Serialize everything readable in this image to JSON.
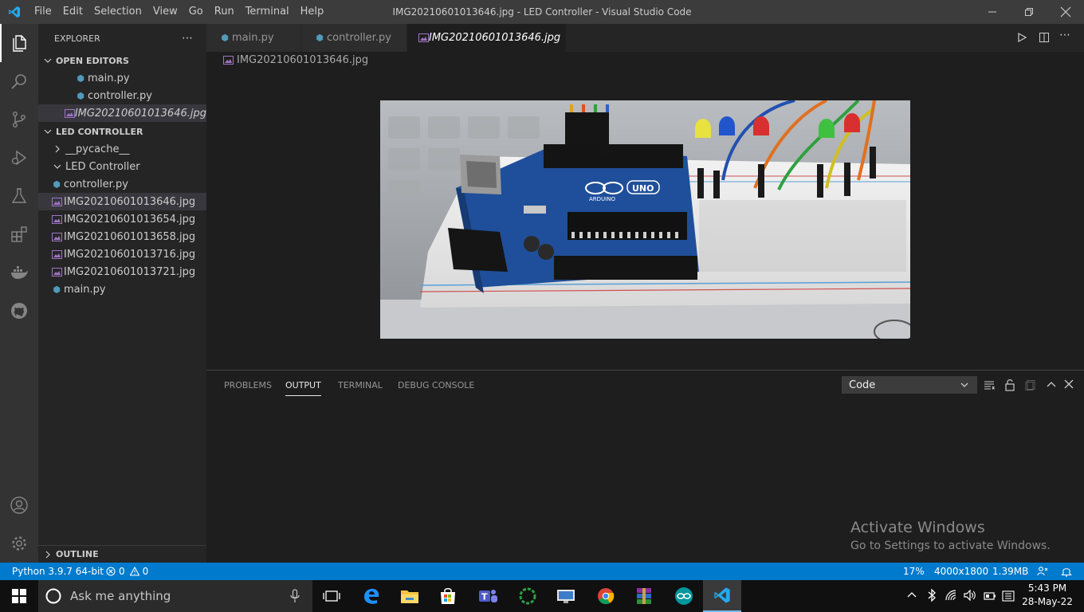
{
  "window": {
    "title": "IMG20210601013646.jpg - LED Controller - Visual Studio Code",
    "menu": [
      "File",
      "Edit",
      "Selection",
      "View",
      "Go",
      "Run",
      "Terminal",
      "Help"
    ]
  },
  "sidebar": {
    "header": "EXPLORER",
    "open_editors": {
      "label": "OPEN EDITORS",
      "items": [
        "main.py",
        "controller.py",
        "IMG20210601013646.jpg"
      ]
    },
    "project": {
      "label": "LED CONTROLLER",
      "items": [
        "__pycache__",
        "LED Controller",
        "controller.py",
        "IMG20210601013646.jpg",
        "IMG20210601013654.jpg",
        "IMG20210601013658.jpg",
        "IMG20210601013716.jpg",
        "IMG20210601013721.jpg",
        "main.py"
      ]
    },
    "outline": "OUTLINE"
  },
  "tabs": [
    "main.py",
    "controller.py",
    "IMG20210601013646.jpg"
  ],
  "editor": {
    "breadcrumb": "IMG20210601013646.jpg",
    "image_labels": {
      "board": "UNO",
      "brand": "ARDUINO"
    }
  },
  "panel": {
    "tabs": [
      "PROBLEMS",
      "OUTPUT",
      "TERMINAL",
      "DEBUG CONSOLE"
    ],
    "active_tab": "OUTPUT",
    "channel": "Code"
  },
  "watermark": {
    "line1": "Activate Windows",
    "line2": "Go to Settings to activate Windows."
  },
  "status": {
    "python": "Python 3.9.7 64-bit",
    "errors": "0",
    "warnings": "0",
    "zoom": "17%",
    "dimensions": "4000x1800",
    "size": "1.39MB"
  },
  "taskbar": {
    "search_placeholder": "Ask me anything",
    "time": "5:43 PM",
    "date": "28-May-22"
  },
  "colors": {
    "accent": "#007acc",
    "python_icon": "#519aba",
    "image_icon": "#a074c4"
  }
}
